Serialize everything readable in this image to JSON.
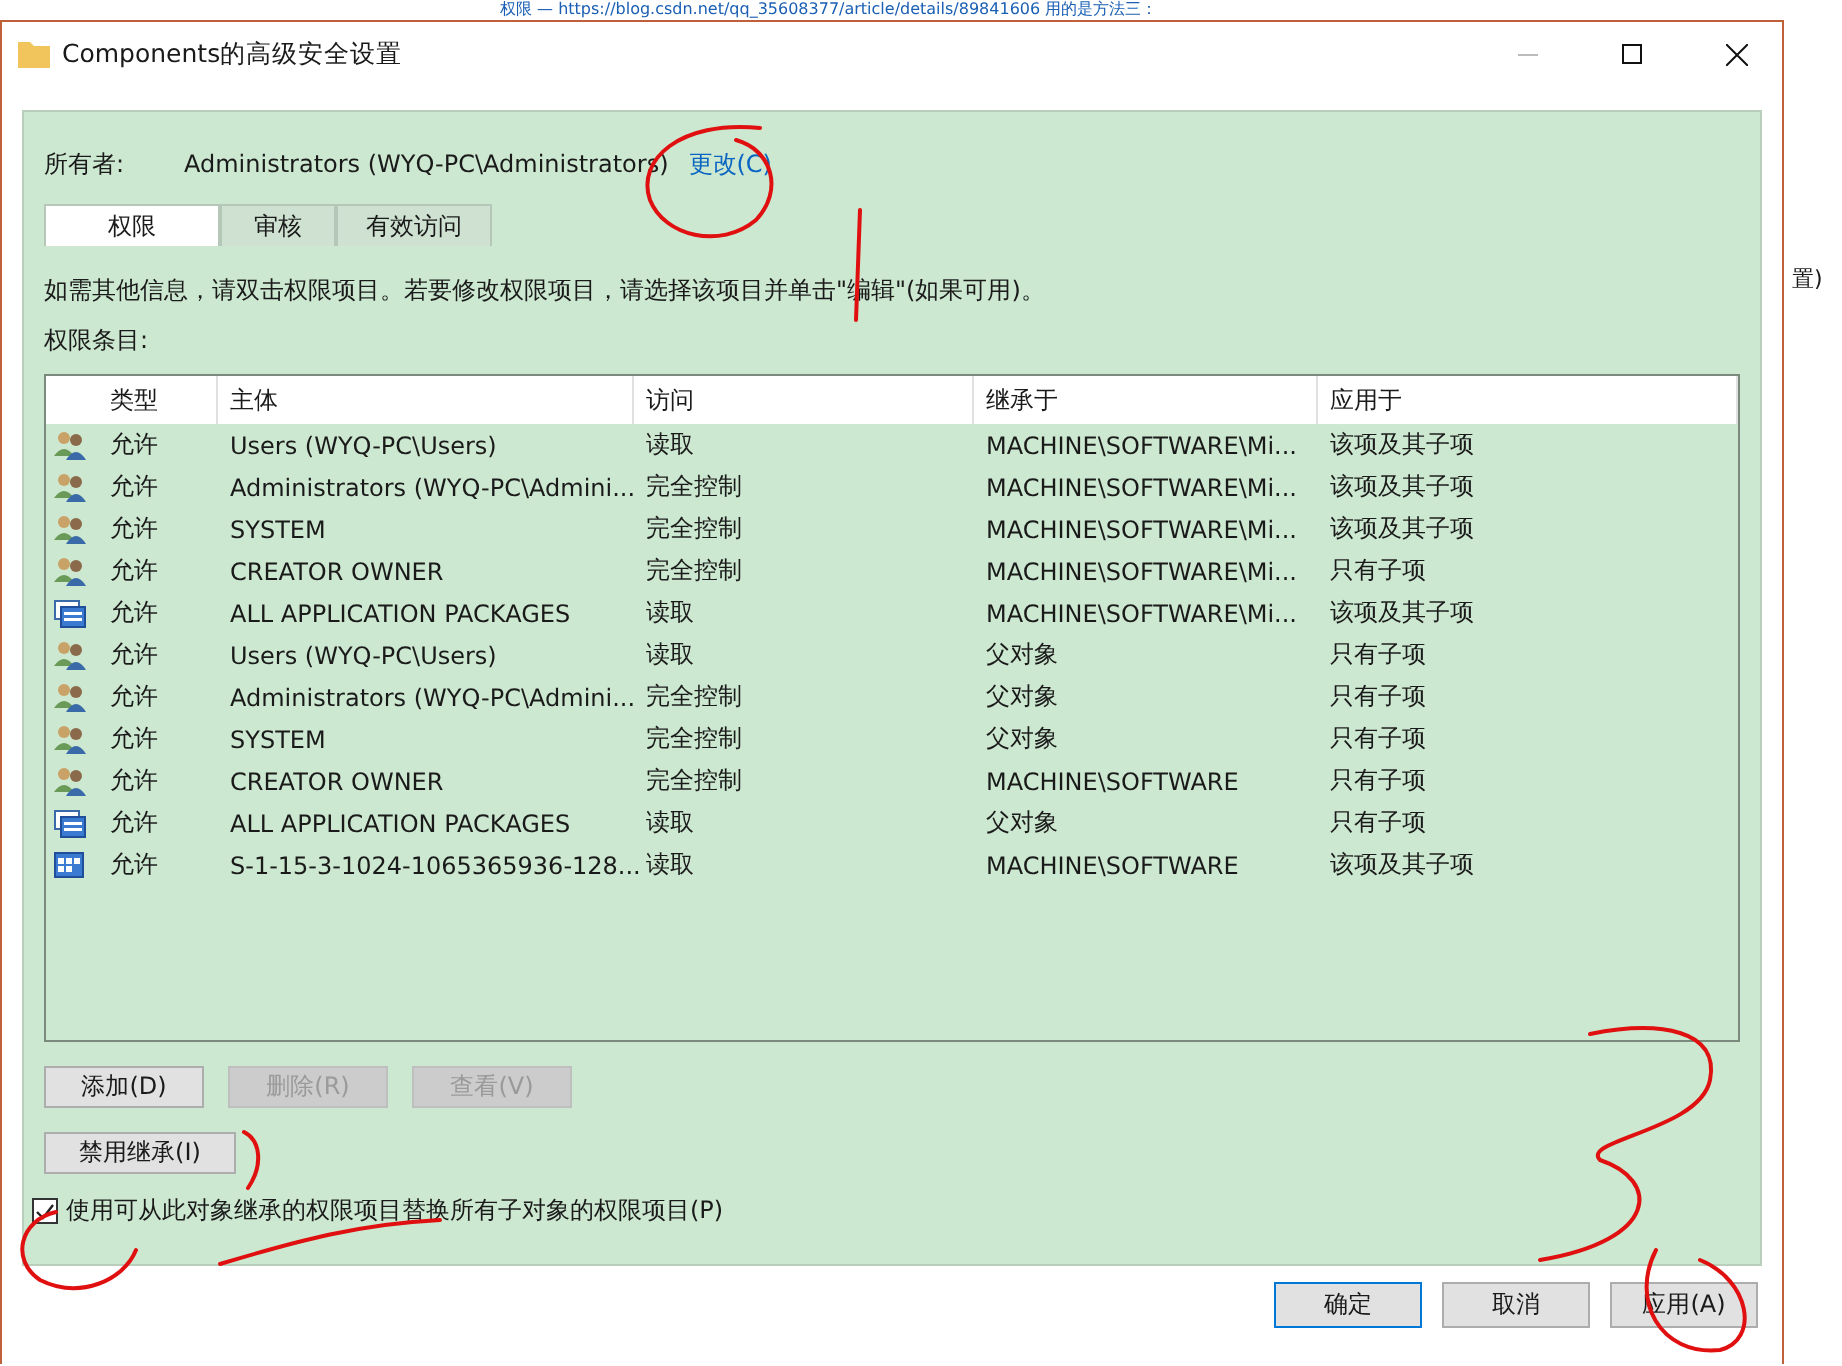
{
  "background": {
    "top_text": "权限 — https://blog.csdn.net/qq_35608377/article/details/89841606 用的是方法三：",
    "side_text": "置)"
  },
  "window": {
    "title": "Components的高级安全设置"
  },
  "owner": {
    "label": "所有者:",
    "value": "Administrators (WYQ-PC\\Administrators)",
    "link": "更改(C)"
  },
  "tabs": [
    {
      "label": "权限",
      "selected": true
    },
    {
      "label": "审核",
      "selected": false
    },
    {
      "label": "有效访问",
      "selected": false
    }
  ],
  "info_text": "如需其他信息，请双击权限项目。若要修改权限项目，请选择该项目并单击\"编辑\"(如果可用)。",
  "entries_label": "权限条目:",
  "table": {
    "columns": [
      "类型",
      "主体",
      "访问",
      "继承于",
      "应用于"
    ],
    "rows": [
      {
        "kind": "group",
        "type": "允许",
        "principal": "Users (WYQ-PC\\Users)",
        "access": "读取",
        "inherited_from": "MACHINE\\SOFTWARE\\Mi...",
        "applies_to": "该项及其子项"
      },
      {
        "kind": "group",
        "type": "允许",
        "principal": "Administrators (WYQ-PC\\Admini...",
        "access": "完全控制",
        "inherited_from": "MACHINE\\SOFTWARE\\Mi...",
        "applies_to": "该项及其子项"
      },
      {
        "kind": "group",
        "type": "允许",
        "principal": "SYSTEM",
        "access": "完全控制",
        "inherited_from": "MACHINE\\SOFTWARE\\Mi...",
        "applies_to": "该项及其子项"
      },
      {
        "kind": "group",
        "type": "允许",
        "principal": "CREATOR OWNER",
        "access": "完全控制",
        "inherited_from": "MACHINE\\SOFTWARE\\Mi...",
        "applies_to": "只有子项"
      },
      {
        "kind": "package",
        "type": "允许",
        "principal": "ALL APPLICATION PACKAGES",
        "access": "读取",
        "inherited_from": "MACHINE\\SOFTWARE\\Mi...",
        "applies_to": "该项及其子项"
      },
      {
        "kind": "group",
        "type": "允许",
        "principal": "Users (WYQ-PC\\Users)",
        "access": "读取",
        "inherited_from": "父对象",
        "applies_to": "只有子项"
      },
      {
        "kind": "group",
        "type": "允许",
        "principal": "Administrators (WYQ-PC\\Admini...",
        "access": "完全控制",
        "inherited_from": "父对象",
        "applies_to": "只有子项"
      },
      {
        "kind": "group",
        "type": "允许",
        "principal": "SYSTEM",
        "access": "完全控制",
        "inherited_from": "父对象",
        "applies_to": "只有子项"
      },
      {
        "kind": "group",
        "type": "允许",
        "principal": "CREATOR OWNER",
        "access": "完全控制",
        "inherited_from": "MACHINE\\SOFTWARE",
        "applies_to": "只有子项"
      },
      {
        "kind": "package",
        "type": "允许",
        "principal": "ALL APPLICATION PACKAGES",
        "access": "读取",
        "inherited_from": "父对象",
        "applies_to": "只有子项"
      },
      {
        "kind": "sid",
        "type": "允许",
        "principal": "S-1-15-3-1024-1065365936-128...",
        "access": "读取",
        "inherited_from": "MACHINE\\SOFTWARE",
        "applies_to": "该项及其子项"
      }
    ]
  },
  "entry_buttons": [
    {
      "label": "添加(D)",
      "disabled": false
    },
    {
      "label": "删除(R)",
      "disabled": true
    },
    {
      "label": "查看(V)",
      "disabled": true
    }
  ],
  "inheritance_button": "禁用继承(I)",
  "replace_checkbox": {
    "label": "使用可从此对象继承的权限项目替换所有子对象的权限项目(P)",
    "checked": true
  },
  "dialog_buttons": [
    {
      "label": "确定",
      "default": true
    },
    {
      "label": "取消",
      "default": false
    },
    {
      "label": "应用(A)",
      "default": false
    }
  ]
}
